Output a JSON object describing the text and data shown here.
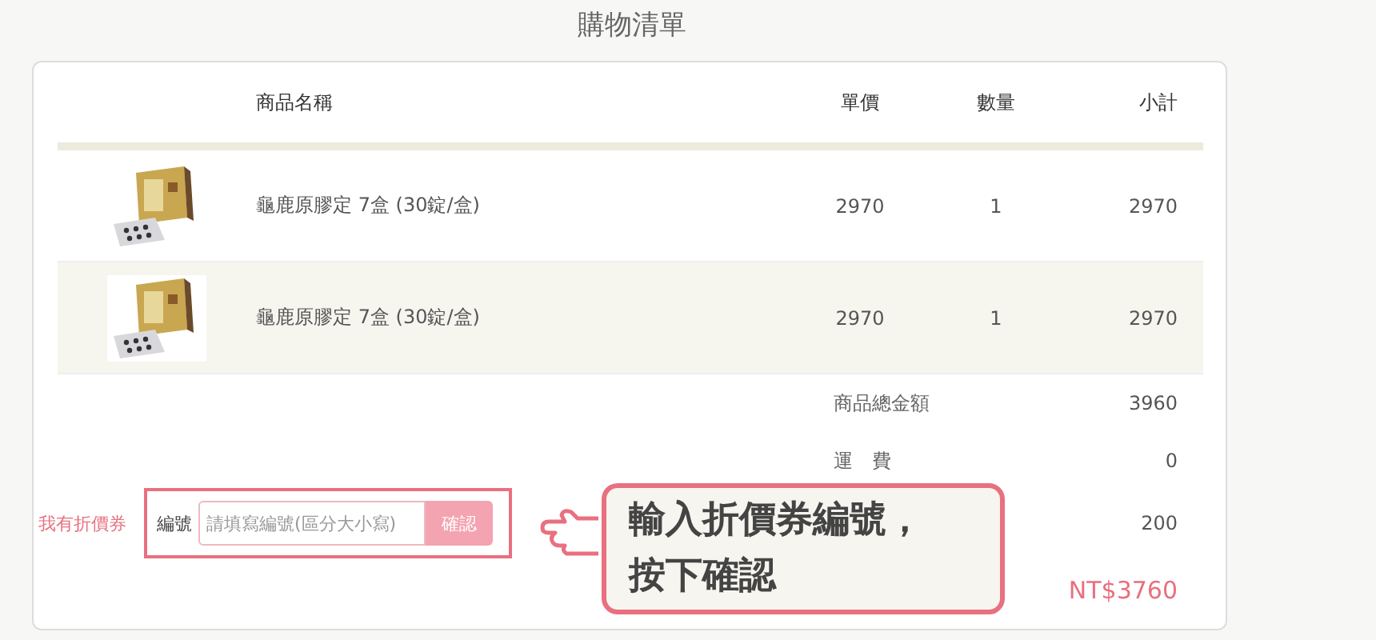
{
  "page_title": "購物清單",
  "table": {
    "columns": [
      "商品名稱",
      "單價",
      "數量",
      "小計"
    ],
    "rows": [
      {
        "name": "龜鹿原膠定 7盒 (30錠/盒)",
        "price": "2970",
        "qty": "1",
        "subtotal": "2970"
      },
      {
        "name": "龜鹿原膠定 7盒 (30錠/盒)",
        "price": "2970",
        "qty": "1",
        "subtotal": "2970"
      }
    ]
  },
  "summary": [
    {
      "kind": "amount",
      "label": "商品總金額",
      "value": "3960"
    },
    {
      "kind": "amount",
      "label": "運　費",
      "value": "0"
    },
    {
      "kind": "amount",
      "value": "200"
    },
    {
      "kind": "total",
      "value": "NT$3760"
    }
  ],
  "coupon": {
    "label": "我有折價券",
    "field_label": "編號",
    "placeholder": "請填寫編號(區分大小寫)",
    "button": "確認"
  },
  "callout": {
    "lines": [
      "輸入折價券編號，",
      "按下確認"
    ]
  }
}
